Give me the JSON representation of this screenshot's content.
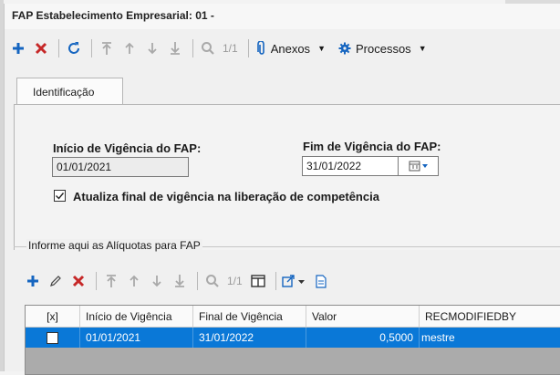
{
  "window": {
    "title": "FAP Estabelecimento Empresarial: 01 -"
  },
  "toolbar": {
    "pager": "1/1",
    "anexos_label": "Anexos",
    "processos_label": "Processos"
  },
  "tabs": [
    {
      "label": "Identificação"
    }
  ],
  "form": {
    "inicio_label": "Início de Vigência do FAP:",
    "inicio_value": "01/01/2021",
    "fim_label": "Fim de Vigência do FAP:",
    "fim_value": "31/01/2022",
    "atualiza_label": "Atualiza final de vigência na liberação de competência",
    "atualiza_checked": true
  },
  "aliquotas": {
    "group_label": "Informe aqui as Alíquotas para FAP",
    "pager": "1/1",
    "columns": [
      "[x]",
      "Início de Vigência",
      "Final de Vigência",
      "Valor",
      "RECMODIFIEDBY"
    ],
    "rows": [
      {
        "checked": false,
        "inicio": "01/01/2021",
        "final": "31/01/2022",
        "valor": "0,5000",
        "recmodifiedby": "mestre"
      }
    ]
  },
  "colors": {
    "accent_blue": "#1565c0",
    "delete_red": "#c62828",
    "selection": "#0a78d7",
    "disabled": "#a9a9a9"
  }
}
